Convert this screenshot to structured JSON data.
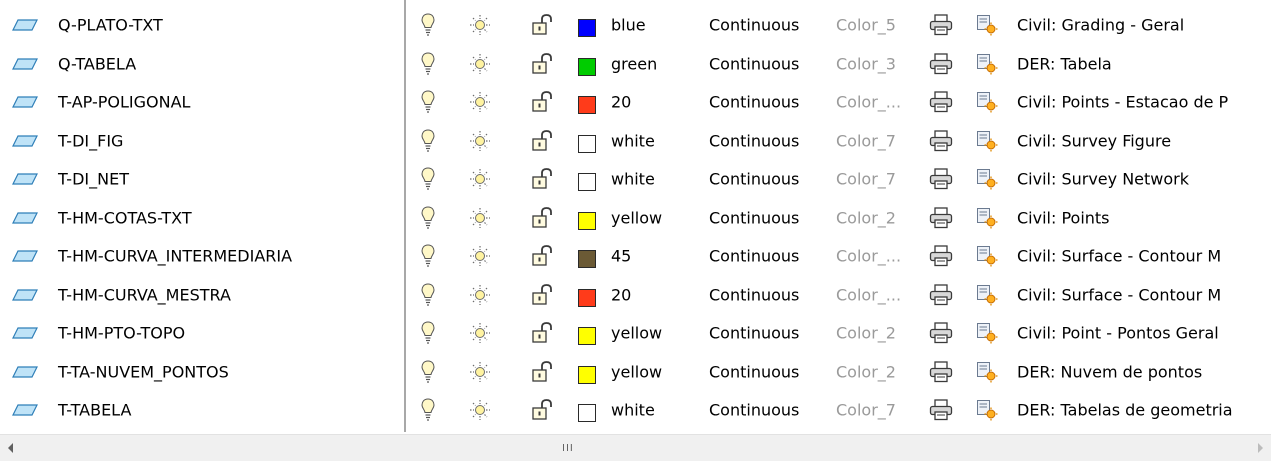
{
  "layers": [
    {
      "name": "Q-PLATO-TXT",
      "swatch": "#0000ff",
      "color_name": "blue",
      "linetype": "Continuous",
      "lineweight": "Color_5",
      "description": "Civil: Grading - Geral"
    },
    {
      "name": "Q-TABELA",
      "swatch": "#00cc00",
      "color_name": "green",
      "linetype": "Continuous",
      "lineweight": "Color_3",
      "description": "DER: Tabela"
    },
    {
      "name": "T-AP-POLIGONAL",
      "swatch": "#ff3b1a",
      "color_name": "20",
      "linetype": "Continuous",
      "lineweight": "Color_...",
      "description": "Civil: Points - Estacao de P"
    },
    {
      "name": "T-DI_FIG",
      "swatch": "#ffffff",
      "color_name": "white",
      "linetype": "Continuous",
      "lineweight": "Color_7",
      "description": "Civil: Survey Figure"
    },
    {
      "name": "T-DI_NET",
      "swatch": "#ffffff",
      "color_name": "white",
      "linetype": "Continuous",
      "lineweight": "Color_7",
      "description": "Civil: Survey Network"
    },
    {
      "name": "T-HM-COTAS-TXT",
      "swatch": "#ffff00",
      "color_name": "yellow",
      "linetype": "Continuous",
      "lineweight": "Color_2",
      "description": "Civil: Points"
    },
    {
      "name": "T-HM-CURVA_INTERMEDIARIA",
      "swatch": "#6b5a35",
      "color_name": "45",
      "linetype": "Continuous",
      "lineweight": "Color_...",
      "description": "Civil: Surface - Contour M"
    },
    {
      "name": "T-HM-CURVA_MESTRA",
      "swatch": "#ff3b1a",
      "color_name": "20",
      "linetype": "Continuous",
      "lineweight": "Color_...",
      "description": "Civil: Surface - Contour M"
    },
    {
      "name": "T-HM-PTO-TOPO",
      "swatch": "#ffff00",
      "color_name": "yellow",
      "linetype": "Continuous",
      "lineweight": "Color_2",
      "description": "Civil: Point - Pontos Geral"
    },
    {
      "name": "T-TA-NUVEM_PONTOS",
      "swatch": "#ffff00",
      "color_name": "yellow",
      "linetype": "Continuous",
      "lineweight": "Color_2",
      "description": "DER: Nuvem de pontos"
    },
    {
      "name": "T-TABELA",
      "swatch": "#ffffff",
      "color_name": "white",
      "linetype": "Continuous",
      "lineweight": "Color_7",
      "description": "DER: Tabelas de geometria"
    }
  ],
  "scrollbar": {
    "grip": "III"
  }
}
